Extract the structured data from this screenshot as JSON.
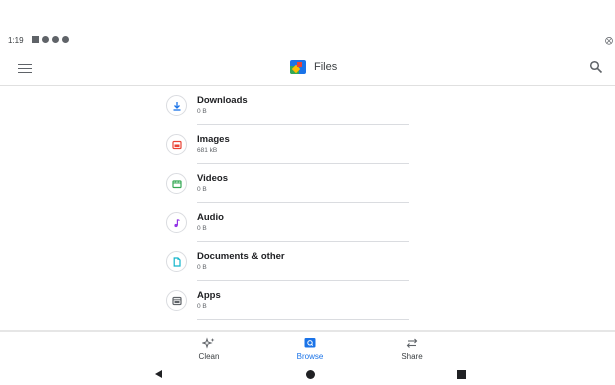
{
  "status_bar": {
    "time": "1:19"
  },
  "app_bar": {
    "title": "Files"
  },
  "categories": [
    {
      "label": "Downloads",
      "size": "0 B",
      "icon": "download-icon",
      "color": "#1a73e8"
    },
    {
      "label": "Images",
      "size": "681 kB",
      "icon": "image-icon",
      "color": "#ea4335"
    },
    {
      "label": "Videos",
      "size": "0 B",
      "icon": "video-icon",
      "color": "#34a853"
    },
    {
      "label": "Audio",
      "size": "0 B",
      "icon": "audio-icon",
      "color": "#9334e6"
    },
    {
      "label": "Documents & other",
      "size": "0 B",
      "icon": "document-icon",
      "color": "#12b5cb"
    },
    {
      "label": "Apps",
      "size": "0 B",
      "icon": "apps-icon",
      "color": "#5f6368"
    }
  ],
  "bottom_nav": {
    "clean_label": "Clean",
    "browse_label": "Browse",
    "share_label": "Share",
    "active": "Browse"
  },
  "colors": {
    "accent": "#1a73e8",
    "divider": "#dadce0"
  }
}
